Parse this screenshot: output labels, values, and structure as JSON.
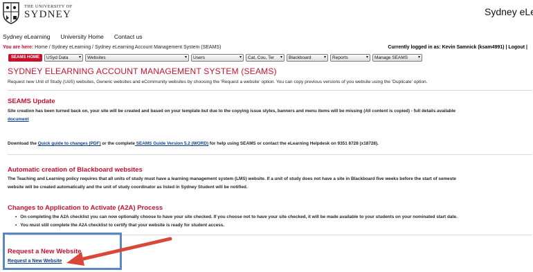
{
  "header": {
    "logo_small": "THE UNIVERSITY OF",
    "logo_big": "SYDNEY",
    "site_title": "Sydney eLe"
  },
  "topnav": [
    "Sydney eLearning",
    "University Home",
    "Contact us"
  ],
  "breadcrumb": {
    "label": "You are here:",
    "path": "Home / Sydney eLearning / Sydney eLearning Account Management System (SEAMS)"
  },
  "login": {
    "prefix": "Currently logged in as: Kevin Samnick (ksam4991)",
    "sep": "|",
    "logout": "Logout",
    "trail": "|"
  },
  "menubar": {
    "home": "SEAMS HOME",
    "dropdowns": [
      "USyd Data",
      "Websites",
      "Users",
      "Cat, Cou, Ter",
      "Blackboard",
      "Reports",
      "Manage SEAMS"
    ]
  },
  "page": {
    "title": "SYDNEY ELEARNING ACCOUNT MANAGEMENT SYSTEM (SEAMS)",
    "intro": "Request new Unit of Study (UoS) websites, Generic websites and eCommunity websites by choosing the 'Request a website' option. You can copy previous versions of you website using the 'Duplicate' option."
  },
  "seams_update": {
    "heading": "SEAMS Update",
    "line1": "Site creation has been turned back on, your site will be created and based on your template but due to the copying issue styles, banners and menu items will be missing (All content is copied) - full details available",
    "link": "document"
  },
  "download": {
    "prefix": "Download the ",
    "link1": "Quick guide to changes (PDF)",
    "middle": " or the complete",
    "link2": " SEAMS Guide Version 5.2 (WORD)",
    "suffix": " for help using SEAMS or contact the eLearning Helpdesk on 9351 8728 (x18728)."
  },
  "auto_creation": {
    "heading": "Automatic creation of Blackboard websites",
    "line1": "The Teaching and Learning policy requires that all units of study must have a learning management system (LMS) website. If a unit of study does not have a site in Blackboard five weeks before the start of semeste",
    "line2": "website will be created automatically and the unit of study coordinator as listed in Sydney Student will be notified."
  },
  "a2a": {
    "heading": "Changes to Application to Activate (A2A) Process",
    "bullets": [
      "On completing the A2A checklist you can now optionally choose to have your site checked. If you choose not to have your site checked, it will be made available to your students on your nominated start date.",
      "You must still complete the A2A checklist to certify that your website is ready for student access."
    ]
  },
  "request": {
    "heading": "Request a New Website",
    "link": "Request a New Website"
  },
  "colors": {
    "brand_red": "#c8102e",
    "link_blue": "#0c3c8c",
    "highlight_blue": "#5b86be",
    "arrow_red": "#d9473b"
  }
}
